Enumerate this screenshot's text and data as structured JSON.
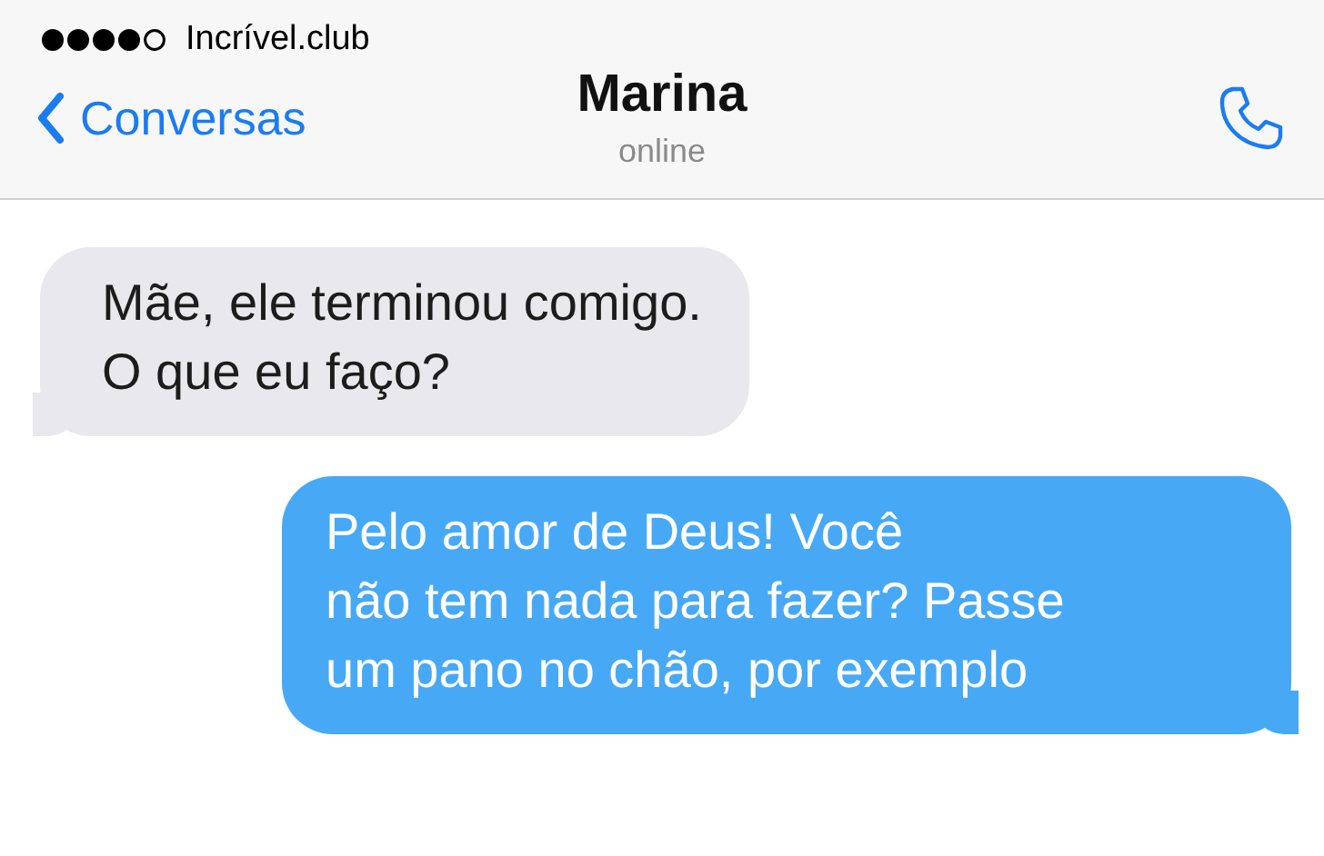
{
  "status_bar": {
    "carrier": "Incrível.club"
  },
  "header": {
    "back": "Conversas",
    "name": "Marina",
    "status": "online"
  },
  "messages": [
    {
      "kind": "incoming",
      "text": "Mãe, ele terminou comigo.\nO que eu faço?"
    },
    {
      "kind": "outgoing",
      "text": "Pelo amor de Deus! Você\nnão tem nada para fazer? Passe\num pano no chão, por exemplo"
    }
  ]
}
